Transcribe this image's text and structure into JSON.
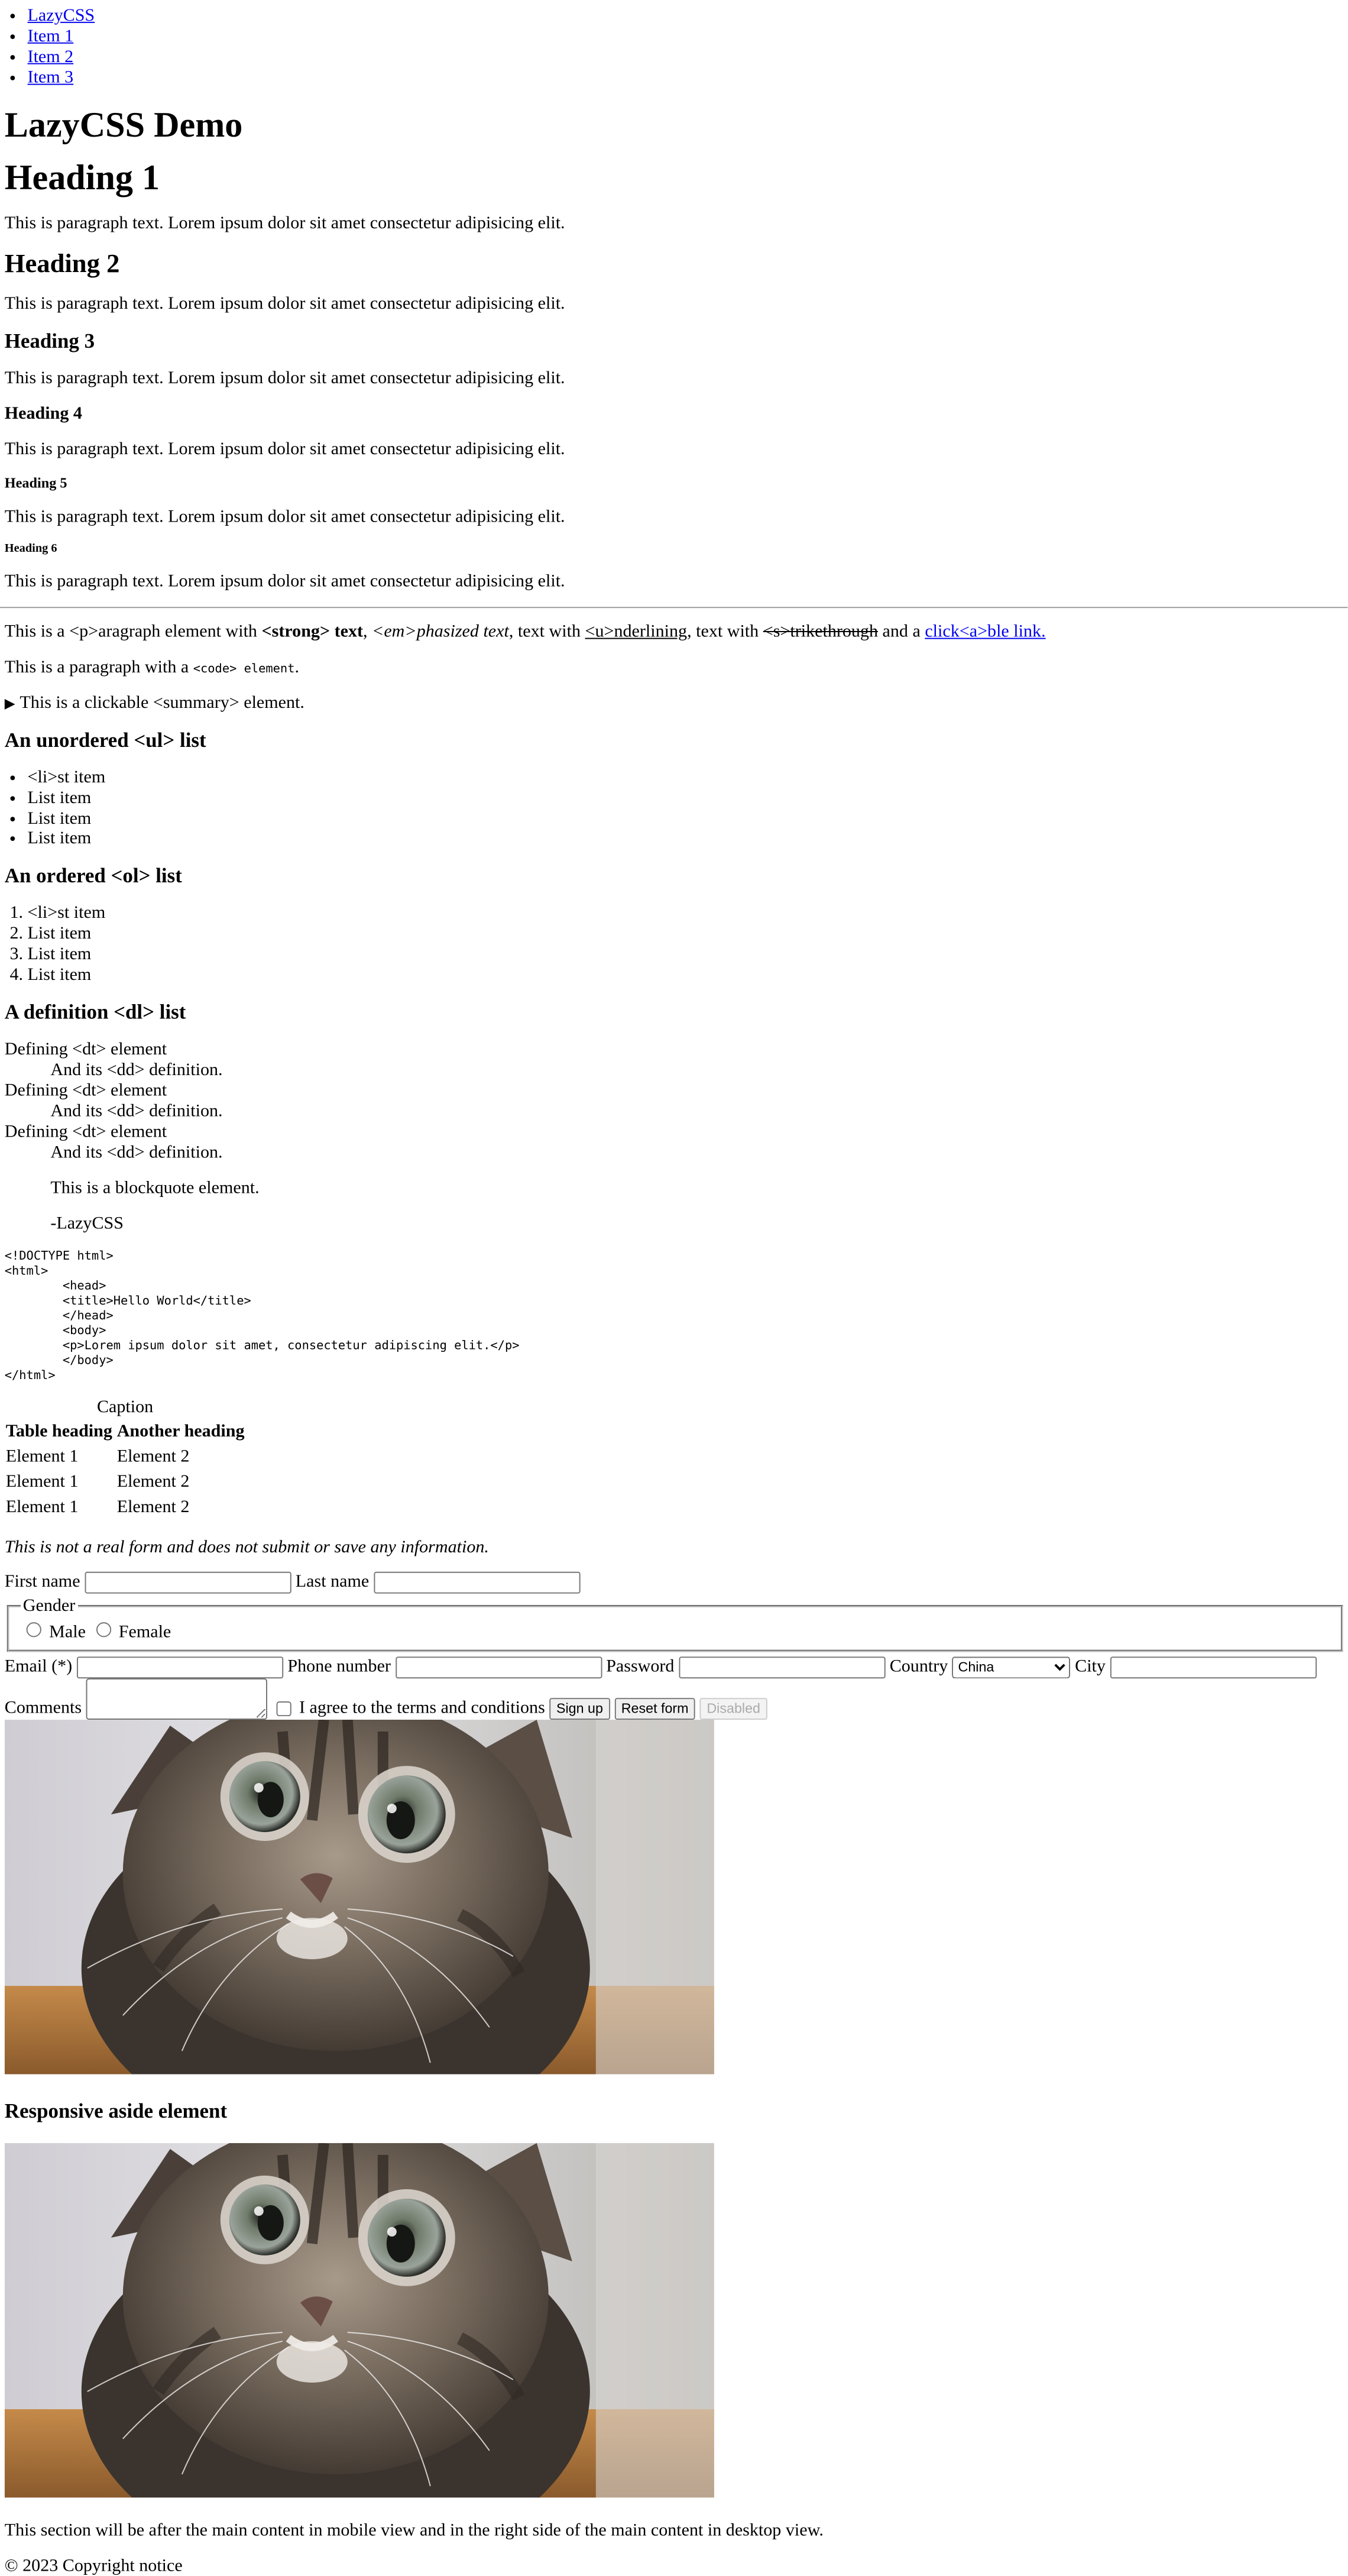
{
  "nav": {
    "items": [
      "LazyCSS",
      "Item 1",
      "Item 2",
      "Item 3"
    ]
  },
  "main": {
    "title": "LazyCSS Demo",
    "headings": [
      "Heading 1",
      "Heading 2",
      "Heading 3",
      "Heading 4",
      "Heading 5",
      "Heading 6"
    ],
    "paragraph_text": "This is paragraph text. Lorem ipsum dolor sit amet consectetur adipisicing elit.",
    "inline": {
      "prefix": "This is a <p>aragraph element with ",
      "strong": "<strong> text",
      "sep1": ", ",
      "em": "<em>phasized text",
      "sep2": ", text with ",
      "underline": "<u>nderlining",
      "sep3": ", text with ",
      "strike": "<s>trikethrough",
      "sep4": " and a ",
      "link": "click<a>ble link."
    },
    "code_para": {
      "prefix": "This is a paragraph with a ",
      "code": "<code> element",
      "suffix": "."
    },
    "summary": "This is a clickable <summary> element.",
    "ul_heading": "An unordered <ul> list",
    "ul_items": [
      "<li>st item",
      "List item",
      "List item",
      "List item"
    ],
    "ol_heading": "An ordered <ol> list",
    "ol_items": [
      "<li>st item",
      "List item",
      "List item",
      "List item"
    ],
    "dl_heading": "A definition <dl> list",
    "dl_term": "Defining <dt> element",
    "dl_def": "And its <dd> definition.",
    "blockquote": {
      "text": "This is a blockquote element.",
      "cite": "-LazyCSS"
    },
    "pre_code": "<!DOCTYPE html>\n<html>\n        <head>\n        <title>Hello World</title>\n        </head>\n        <body>\n        <p>Lorem ipsum dolor sit amet, consectetur adipiscing elit.</p>\n        </body>\n</html>",
    "table": {
      "caption": "Caption",
      "headers": [
        "Table heading",
        "Another heading"
      ],
      "rows": [
        [
          "Element 1",
          "Element 2"
        ],
        [
          "Element 1",
          "Element 2"
        ],
        [
          "Element 1",
          "Element 2"
        ]
      ]
    },
    "form": {
      "note": "This is not a real form and does not submit or save any information.",
      "first_name_label": "First name",
      "last_name_label": "Last name",
      "gender_legend": "Gender",
      "gender_options": [
        "Male",
        "Female"
      ],
      "email_label": "Email (*)",
      "phone_label": "Phone number",
      "password_label": "Password",
      "country_label": "Country",
      "country_value": "China",
      "city_label": "City",
      "comments_label": "Comments",
      "terms_label": "I agree to the terms and conditions",
      "signup_label": "Sign up",
      "reset_label": "Reset form",
      "disabled_label": "Disabled"
    }
  },
  "aside": {
    "heading": "Responsive aside element",
    "text": "This section will be after the main content in mobile view and in the right side of the main content in desktop view."
  },
  "footer": {
    "text": "© 2023 Copyright notice"
  },
  "colors": {
    "link": "#0000ee",
    "background": "#ffffff",
    "text": "#000000"
  }
}
